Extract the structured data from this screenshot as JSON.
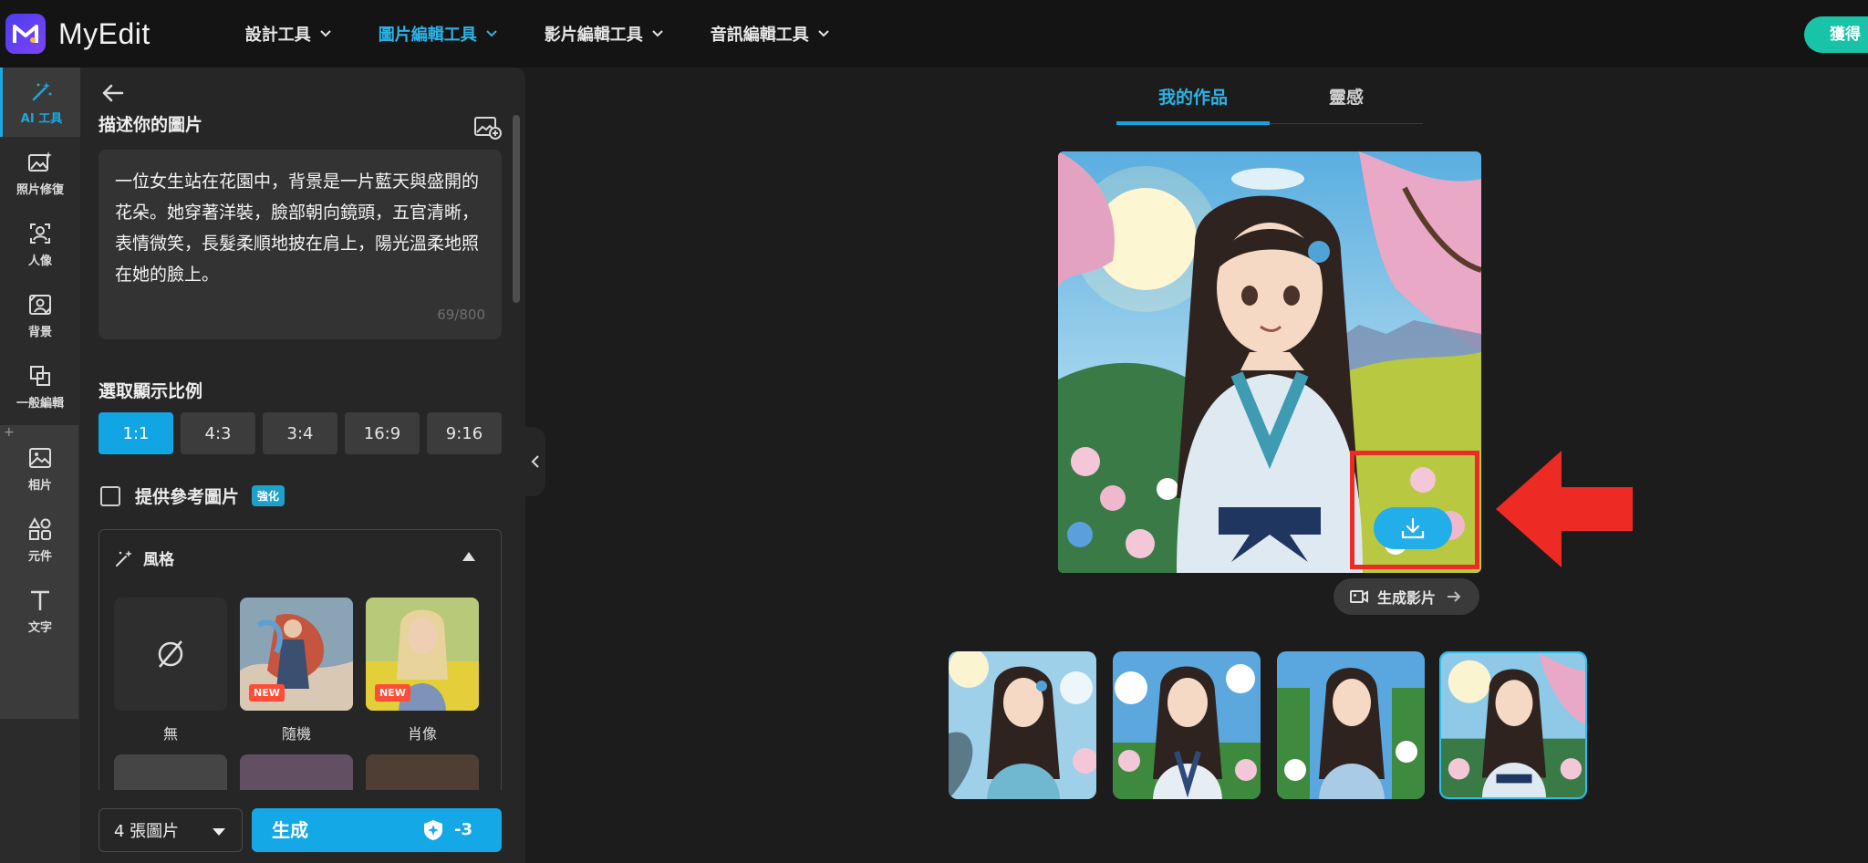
{
  "app": {
    "name": "MyEdit",
    "get_button": "獲得"
  },
  "nav": [
    {
      "label": "設計工具"
    },
    {
      "label": "圖片編輯工具",
      "active": true
    },
    {
      "label": "影片編輯工具"
    },
    {
      "label": "音訊編輯工具"
    }
  ],
  "rail": {
    "ai_tools": "AI 工具",
    "photo_repair": "照片修復",
    "portrait": "人像",
    "background": "背景",
    "general_edit": "一般編輯",
    "photos": "相片",
    "elements": "元件",
    "text": "文字"
  },
  "panel": {
    "describe_title": "描述你的圖片",
    "prompt_text": "一位女生站在花園中，背景是一片藍天與盛開的花朵。她穿著洋裝，臉部朝向鏡頭，五官清晰，表情微笑，長髮柔順地披在肩上，陽光溫柔地照在她的臉上。",
    "char_count": "69/800",
    "ratio_title": "選取顯示比例",
    "ratios": [
      "1:1",
      "4:3",
      "3:4",
      "16:9",
      "9:16"
    ],
    "selected_ratio": "1:1",
    "reference_label": "提供參考圖片",
    "boost_badge": "強化",
    "style_title": "風格",
    "styles": [
      {
        "label": "無"
      },
      {
        "label": "隨機",
        "badge": "NEW"
      },
      {
        "label": "肖像",
        "badge": "NEW"
      }
    ],
    "count_select": "4 張圖片",
    "generate_label": "生成",
    "credit_cost": "-3"
  },
  "main": {
    "tabs": [
      "我的作品",
      "靈感"
    ],
    "active_tab": "我的作品",
    "generate_video_label": "生成影片",
    "thumbnail_count": 4,
    "selected_thumbnail": 4
  },
  "colors": {
    "accent": "#14a8e6",
    "annotation": "#ee2a24",
    "brand": "#4b3df0",
    "get_button": "#19c3a7"
  }
}
